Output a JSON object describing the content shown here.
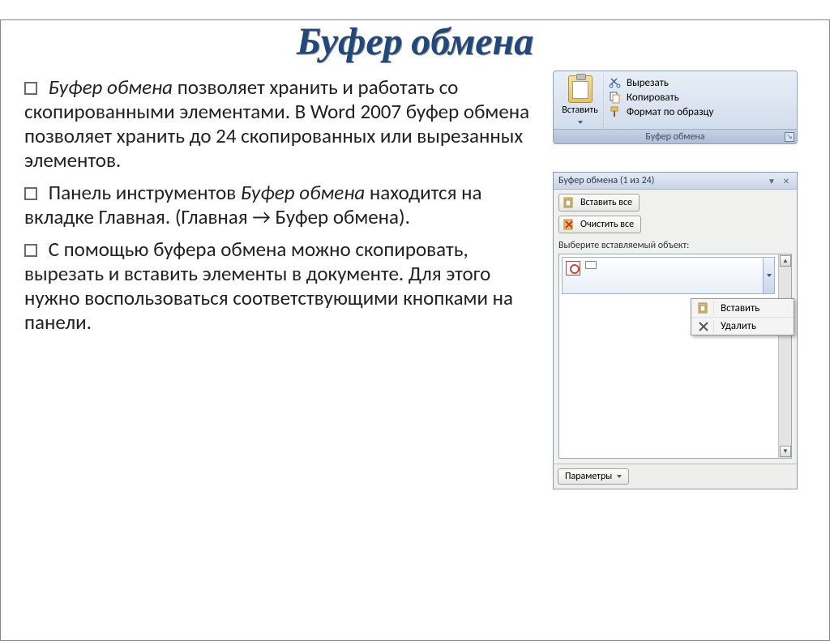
{
  "title": "Буфер обмена",
  "bullets": {
    "p1_italic": "Буфер обмена",
    "p1_rest": " позволяет хранить и работать со скопированными элементами. В Word 2007 буфер обмена позволяет хранить до 24 скопированных или вырезанных элементов.",
    "p2_a": "Панель инструментов ",
    "p2_italic": "Буфер обмена",
    "p2_b": " находится на вкладке Главная.  (Главная → Буфер обмена).",
    "p3": "С помощью буфера обмена можно скопировать, вырезать и вставить элементы в документе. Для этого нужно воспользоваться соответствующими кнопками на панели."
  },
  "ribbon": {
    "paste": "Вставить",
    "cut": "Вырезать",
    "copy": "Копировать",
    "format_painter": "Формат по образцу",
    "group_caption": "Буфер обмена"
  },
  "pane": {
    "header": "Буфер обмена (1 из 24)",
    "paste_all": "Вставить все",
    "clear_all": "Очистить все",
    "select_label": "Выберите вставляемый объект:",
    "ctx_paste": "Вставить",
    "ctx_delete": "Удалить",
    "params": "Параметры"
  }
}
